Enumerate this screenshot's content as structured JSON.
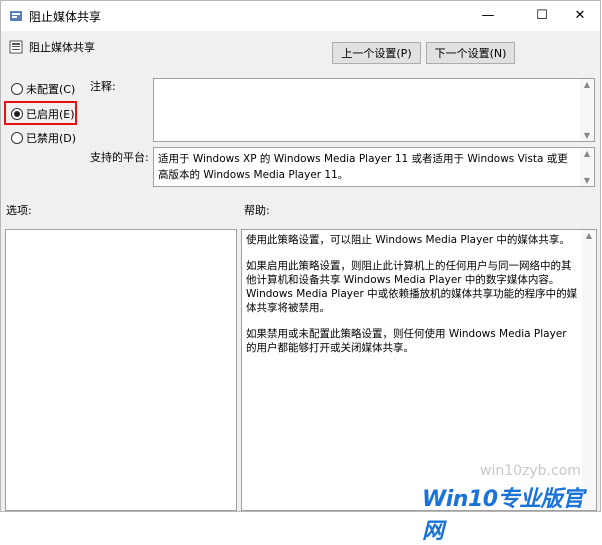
{
  "window": {
    "title": "阻止媒体共享",
    "min_glyph": "—",
    "max_glyph": "☐",
    "close_glyph": "✕"
  },
  "policy": {
    "title": "阻止媒体共享",
    "prev_button": "上一个设置(P)",
    "next_button": "下一个设置(N)"
  },
  "radios": [
    {
      "label": "未配置(C)",
      "selected": false
    },
    {
      "label": "已启用(E)",
      "selected": true
    },
    {
      "label": "已禁用(D)",
      "selected": false
    }
  ],
  "labels": {
    "comment": "注释:",
    "platform": "支持的平台:",
    "options": "选项:",
    "help": "帮助:"
  },
  "platform_text": "适用于 Windows XP 的 Windows Media Player 11 或者适用于 Windows Vista 或更高版本的 Windows Media Player 11。",
  "help_paragraphs": [
    "使用此策略设置，可以阻止 Windows Media Player 中的媒体共享。",
    "如果启用此策略设置，则阻止此计算机上的任何用户与同一网络中的其他计算机和设备共享 Windows Media Player 中的数字媒体内容。Windows Media Player 中或依赖播放机的媒体共享功能的程序中的媒体共享将被禁用。",
    "如果禁用或未配置此策略设置，则任何使用 Windows Media Player 的用户都能够打开或关闭媒体共享。"
  ],
  "watermark": {
    "url": "win10zyb.com",
    "logo": "Win10专业版官网"
  },
  "colors": {
    "highlight_border": "#e51414",
    "logo_blue": "#1a73d9"
  }
}
